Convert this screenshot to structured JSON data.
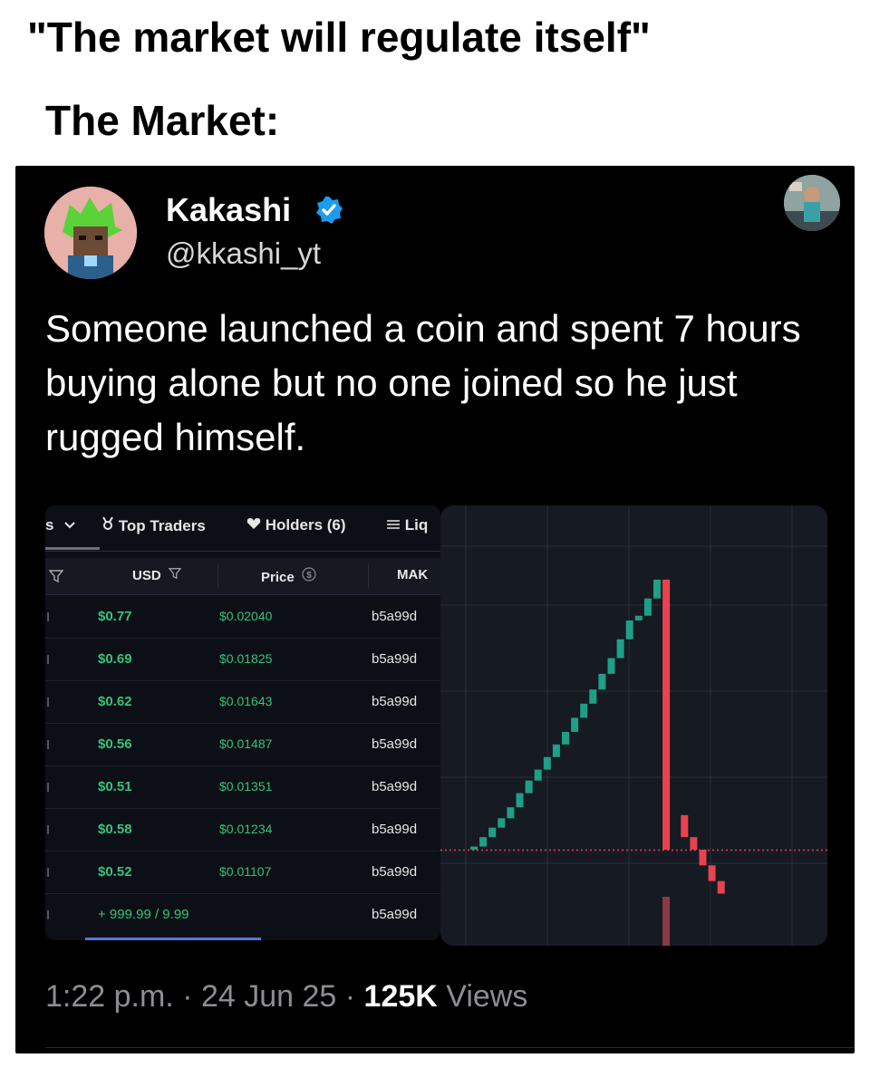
{
  "meme": {
    "caption": "\"The market will regulate itself\"",
    "subcaption": "The Market:"
  },
  "tweet": {
    "author_name": "Kakashi",
    "handle": "@kkashi_yt",
    "verified": true,
    "text": "Someone launched a coin and spent 7 hours buying alone but no one joined so he just rugged himself.",
    "timestamp": "1:22 p.m. · 24 Jun 25 · ",
    "views_count": "125K",
    "views_label": " Views"
  },
  "trades_table": {
    "tabs": [
      {
        "label": "s",
        "icon": "chevron-down-icon"
      },
      {
        "label": "Top Traders",
        "icon": "trophy-icon"
      },
      {
        "label": "Holders (6)",
        "icon": "heart-icon"
      },
      {
        "label": "Liq",
        "icon": "list-icon"
      }
    ],
    "columns": [
      "USD",
      "Price",
      "MAK"
    ],
    "rows": [
      {
        "usd": "$0.77",
        "price": "$0.02040",
        "maker": "b5a99d"
      },
      {
        "usd": "$0.69",
        "price": "$0.01825",
        "maker": "b5a99d"
      },
      {
        "usd": "$0.62",
        "price": "$0.01643",
        "maker": "b5a99d"
      },
      {
        "usd": "$0.56",
        "price": "$0.01487",
        "maker": "b5a99d"
      },
      {
        "usd": "$0.51",
        "price": "$0.01351",
        "maker": "b5a99d"
      },
      {
        "usd": "$0.58",
        "price": "$0.01234",
        "maker": "b5a99d"
      },
      {
        "usd": "$0.52",
        "price": "$0.01107",
        "maker": "b5a99d"
      },
      {
        "usd": "+ 999.99 / 9.99",
        "price": "",
        "maker": "b5a99d"
      }
    ]
  },
  "colors": {
    "up": "#1f9f86",
    "down": "#e8424f",
    "grid": "#2a2f3b",
    "chart_bg": "#161a22",
    "accent": "#5b74d9"
  },
  "chart_data": {
    "type": "candlestick",
    "candles": [
      {
        "open": 0,
        "close": 2
      },
      {
        "open": 2,
        "close": 8
      },
      {
        "open": 8,
        "close": 14
      },
      {
        "open": 14,
        "close": 20
      },
      {
        "open": 20,
        "close": 27
      },
      {
        "open": 27,
        "close": 36
      },
      {
        "open": 36,
        "close": 44
      },
      {
        "open": 44,
        "close": 51
      },
      {
        "open": 51,
        "close": 59
      },
      {
        "open": 59,
        "close": 67
      },
      {
        "open": 67,
        "close": 75
      },
      {
        "open": 75,
        "close": 84
      },
      {
        "open": 84,
        "close": 93
      },
      {
        "open": 93,
        "close": 102
      },
      {
        "open": 102,
        "close": 112
      },
      {
        "open": 112,
        "close": 122
      },
      {
        "open": 122,
        "close": 134
      },
      {
        "open": 134,
        "close": 146
      },
      {
        "open": 146,
        "close": 149
      },
      {
        "open": 149,
        "close": 160
      },
      {
        "open": 160,
        "close": 172
      },
      {
        "open": 172,
        "close": 0
      },
      {
        "open": 0,
        "close": 0
      },
      {
        "open": 22,
        "close": 8
      },
      {
        "open": 8,
        "close": 0
      },
      {
        "open": 0,
        "close": -10
      },
      {
        "open": -10,
        "close": -20
      },
      {
        "open": -20,
        "close": -28
      }
    ],
    "ylim": [
      -30,
      180
    ]
  }
}
